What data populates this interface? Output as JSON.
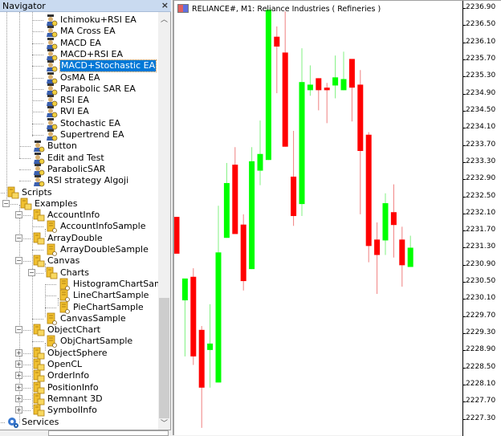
{
  "navigator": {
    "title": "Navigator",
    "close_label": "×",
    "items": [
      {
        "label": "Ichimoku+RSI EA",
        "level": 4,
        "icon": "expert-advisor-icon"
      },
      {
        "label": "MA Cross EA",
        "level": 4,
        "icon": "expert-advisor-icon"
      },
      {
        "label": "MACD EA",
        "level": 4,
        "icon": "expert-advisor-icon"
      },
      {
        "label": "MACD+RSI EA",
        "level": 4,
        "icon": "expert-advisor-icon"
      },
      {
        "label": "MACD+Stochastic EA",
        "level": 4,
        "icon": "expert-advisor-icon",
        "selected": true
      },
      {
        "label": "OsMA EA",
        "level": 4,
        "icon": "expert-advisor-icon"
      },
      {
        "label": "Parabolic SAR EA",
        "level": 4,
        "icon": "expert-advisor-icon"
      },
      {
        "label": "RSI EA",
        "level": 4,
        "icon": "expert-advisor-icon"
      },
      {
        "label": "RVI EA",
        "level": 4,
        "icon": "expert-advisor-icon"
      },
      {
        "label": "Stochastic EA",
        "level": 4,
        "icon": "expert-advisor-icon"
      },
      {
        "label": "Supertrend EA",
        "level": 4,
        "icon": "expert-advisor-icon"
      },
      {
        "label": "Button",
        "level": 3,
        "icon": "expert-advisor-icon"
      },
      {
        "label": "Edit and Test",
        "level": 3,
        "icon": "expert-advisor-icon"
      },
      {
        "label": "ParabolicSAR",
        "level": 3,
        "icon": "expert-advisor-icon"
      },
      {
        "label": "RSI strategy Algoji",
        "level": 3,
        "icon": "expert-advisor-icon"
      },
      {
        "label": "Scripts",
        "level": 1,
        "icon": "scripts-folder-icon",
        "toggle": "-"
      },
      {
        "label": "Examples",
        "level": 2,
        "icon": "folder-icon",
        "toggle": "-"
      },
      {
        "label": "AccountInfo",
        "level": 3,
        "icon": "folder-icon",
        "toggle": "-"
      },
      {
        "label": "AccountInfoSample",
        "level": 4,
        "icon": "script-icon"
      },
      {
        "label": "ArrayDouble",
        "level": 3,
        "icon": "folder-icon",
        "toggle": "-"
      },
      {
        "label": "ArrayDoubleSample",
        "level": 4,
        "icon": "script-icon"
      },
      {
        "label": "Canvas",
        "level": 3,
        "icon": "folder-icon",
        "toggle": "-"
      },
      {
        "label": "Charts",
        "level": 4,
        "icon": "folder-icon",
        "toggle": "-"
      },
      {
        "label": "HistogramChartSample",
        "level": 5,
        "icon": "script-icon"
      },
      {
        "label": "LineChartSample",
        "level": 5,
        "icon": "script-icon"
      },
      {
        "label": "PieChartSample",
        "level": 5,
        "icon": "script-icon"
      },
      {
        "label": "CanvasSample",
        "level": 4,
        "icon": "script-icon"
      },
      {
        "label": "ObjectChart",
        "level": 3,
        "icon": "folder-icon",
        "toggle": "-"
      },
      {
        "label": "ObjChartSample",
        "level": 4,
        "icon": "script-icon"
      },
      {
        "label": "ObjectSphere",
        "level": 3,
        "icon": "folder-icon",
        "toggle": "+"
      },
      {
        "label": "OpenCL",
        "level": 3,
        "icon": "folder-icon",
        "toggle": "+"
      },
      {
        "label": "OrderInfo",
        "level": 3,
        "icon": "folder-icon",
        "toggle": "+"
      },
      {
        "label": "PositionInfo",
        "level": 3,
        "icon": "folder-icon",
        "toggle": "+"
      },
      {
        "label": "Remnant 3D",
        "level": 3,
        "icon": "folder-icon",
        "toggle": "+"
      },
      {
        "label": "SymbolInfo",
        "level": 3,
        "icon": "folder-icon",
        "toggle": "+"
      },
      {
        "label": "Services",
        "level": 1,
        "icon": "services-icon"
      }
    ]
  },
  "chart": {
    "title": "RELIANCE#, M1:  Reliance Industries ( Refineries )",
    "colors": {
      "bull": "#00ff00",
      "bear": "#ff0000",
      "bull_wick": "#80f080",
      "bear_wick": "#f08080"
    }
  },
  "chart_data": {
    "type": "candlestick",
    "title": "RELIANCE#, M1:  Reliance Industries ( Refineries )",
    "xlabel": "",
    "ylabel": "",
    "ylim": [
      2227.0,
      2237.05
    ],
    "y_ticks": [
      "2236.90",
      "2236.50",
      "2236.10",
      "2235.70",
      "2235.30",
      "2234.90",
      "2234.50",
      "2234.10",
      "2233.70",
      "2233.30",
      "2232.90",
      "2232.50",
      "2232.10",
      "2231.70",
      "2231.30",
      "2230.90",
      "2230.50",
      "2230.10",
      "2229.70",
      "2229.30",
      "2228.90",
      "2228.50",
      "2228.10",
      "2227.70",
      "2227.30"
    ],
    "candles": [
      {
        "o": 2232.02,
        "h": 2232.02,
        "l": 2231.16,
        "c": 2231.16
      },
      {
        "o": 2230.07,
        "h": 2230.56,
        "l": 2228.76,
        "c": 2230.58
      },
      {
        "o": 2230.62,
        "h": 2230.82,
        "l": 2228.56,
        "c": 2228.76
      },
      {
        "o": 2229.38,
        "h": 2229.47,
        "l": 2227.09,
        "c": 2228.03
      },
      {
        "o": 2228.91,
        "h": 2229.98,
        "l": 2228.03,
        "c": 2229.06
      },
      {
        "o": 2228.15,
        "h": 2232.28,
        "l": 2228.15,
        "c": 2231.19
      },
      {
        "o": 2231.53,
        "h": 2233.28,
        "l": 2231.53,
        "c": 2232.81
      },
      {
        "o": 2233.24,
        "h": 2233.65,
        "l": 2231.62,
        "c": 2231.62
      },
      {
        "o": 2231.84,
        "h": 2232.08,
        "l": 2230.3,
        "c": 2230.52
      },
      {
        "o": 2230.8,
        "h": 2233.65,
        "l": 2230.8,
        "c": 2233.32
      },
      {
        "o": 2233.1,
        "h": 2234.27,
        "l": 2232.76,
        "c": 2233.49
      },
      {
        "o": 2233.35,
        "h": 2236.86,
        "l": 2233.35,
        "c": 2236.86
      },
      {
        "o": 2236.23,
        "h": 2236.47,
        "l": 2234.91,
        "c": 2236.0
      },
      {
        "o": 2235.86,
        "h": 2236.82,
        "l": 2233.66,
        "c": 2233.66
      },
      {
        "o": 2232.96,
        "h": 2234.03,
        "l": 2231.81,
        "c": 2232.04
      },
      {
        "o": 2232.32,
        "h": 2235.96,
        "l": 2232.04,
        "c": 2235.17
      },
      {
        "o": 2234.98,
        "h": 2235.56,
        "l": 2234.85,
        "c": 2235.11
      },
      {
        "o": 2235.26,
        "h": 2235.26,
        "l": 2234.51,
        "c": 2234.98
      },
      {
        "o": 2235.04,
        "h": 2235.15,
        "l": 2234.21,
        "c": 2234.98
      },
      {
        "o": 2235.09,
        "h": 2235.79,
        "l": 2234.79,
        "c": 2235.28
      },
      {
        "o": 2234.98,
        "h": 2235.88,
        "l": 2234.98,
        "c": 2235.24
      },
      {
        "o": 2235.71,
        "h": 2235.71,
        "l": 2234.25,
        "c": 2235.04
      },
      {
        "o": 2235.11,
        "h": 2235.45,
        "l": 2232.08,
        "c": 2233.56
      },
      {
        "o": 2233.94,
        "h": 2234.0,
        "l": 2230.96,
        "c": 2231.34
      },
      {
        "o": 2231.49,
        "h": 2231.89,
        "l": 2230.22,
        "c": 2231.13
      },
      {
        "o": 2231.47,
        "h": 2232.57,
        "l": 2231.13,
        "c": 2232.34
      },
      {
        "o": 2232.13,
        "h": 2232.78,
        "l": 2231.07,
        "c": 2231.83
      },
      {
        "o": 2231.49,
        "h": 2231.79,
        "l": 2230.39,
        "c": 2230.89
      },
      {
        "o": 2230.85,
        "h": 2231.58,
        "l": 2230.85,
        "c": 2231.3
      }
    ]
  }
}
